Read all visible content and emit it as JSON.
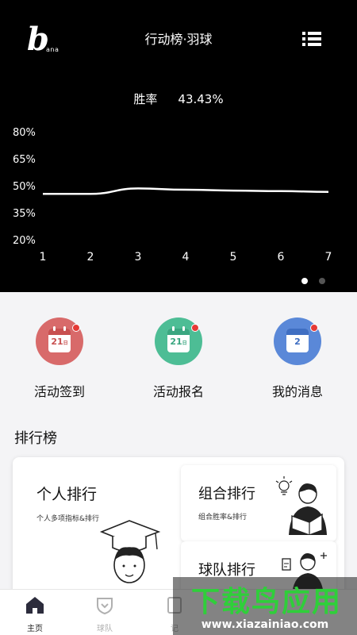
{
  "header": {
    "logo_text": "b",
    "logo_subtext": "ana",
    "title": "行动榜·羽球"
  },
  "stat": {
    "label": "胜率",
    "value": "43.43%"
  },
  "chart_data": {
    "type": "line",
    "x": [
      1,
      2,
      3,
      4,
      5,
      6,
      7
    ],
    "y_tick_labels": [
      "80%",
      "65%",
      "50%",
      "35%",
      "20%"
    ],
    "y_ticks": [
      80,
      65,
      50,
      35,
      20
    ],
    "ylim": [
      20,
      80
    ],
    "xlim": [
      1,
      7
    ],
    "series": [
      {
        "values": [
          45.5,
          45.5,
          48.5,
          47.8,
          47.3,
          47.0,
          46.6
        ]
      }
    ],
    "grid": false,
    "line_color": "#ffffff"
  },
  "carousel": {
    "pages": 2,
    "active": 1
  },
  "actions": [
    {
      "label": "活动签到",
      "icon": "calendar-checkin-icon",
      "icon_text": "21",
      "icon_unit": "日",
      "color": "#d86a6a",
      "band": "#c85050"
    },
    {
      "label": "活动报名",
      "icon": "calendar-signup-icon",
      "icon_text": "21",
      "icon_unit": "日",
      "color": "#4dbd95",
      "band": "#3aa680"
    },
    {
      "label": "我的消息",
      "icon": "message-clock-icon",
      "icon_text": "2",
      "color": "#5a88d8",
      "band": "#3f6ec2"
    }
  ],
  "ranking": {
    "section_title": "排行榜",
    "personal": {
      "title": "个人排行",
      "subtitle": "个人多项指标&排行"
    },
    "combo": {
      "title": "组合排行",
      "subtitle": "组合胜率&排行"
    },
    "team": {
      "title": "球队排行"
    }
  },
  "tabs": [
    {
      "label": "主页",
      "icon": "home-icon",
      "active": true
    },
    {
      "label": "球队",
      "icon": "team-badge-icon",
      "active": false
    },
    {
      "label": "记",
      "icon": "record-icon",
      "active": false
    }
  ],
  "watermark": {
    "main": "下载鸟应用",
    "sub": "www.xiazainiao.com"
  },
  "colors": {
    "hero_bg": "#000000",
    "page_bg": "#f4f4f6",
    "badge": "#e53935",
    "active_tab": "#222222",
    "inactive_tab": "#b0b0b0"
  }
}
